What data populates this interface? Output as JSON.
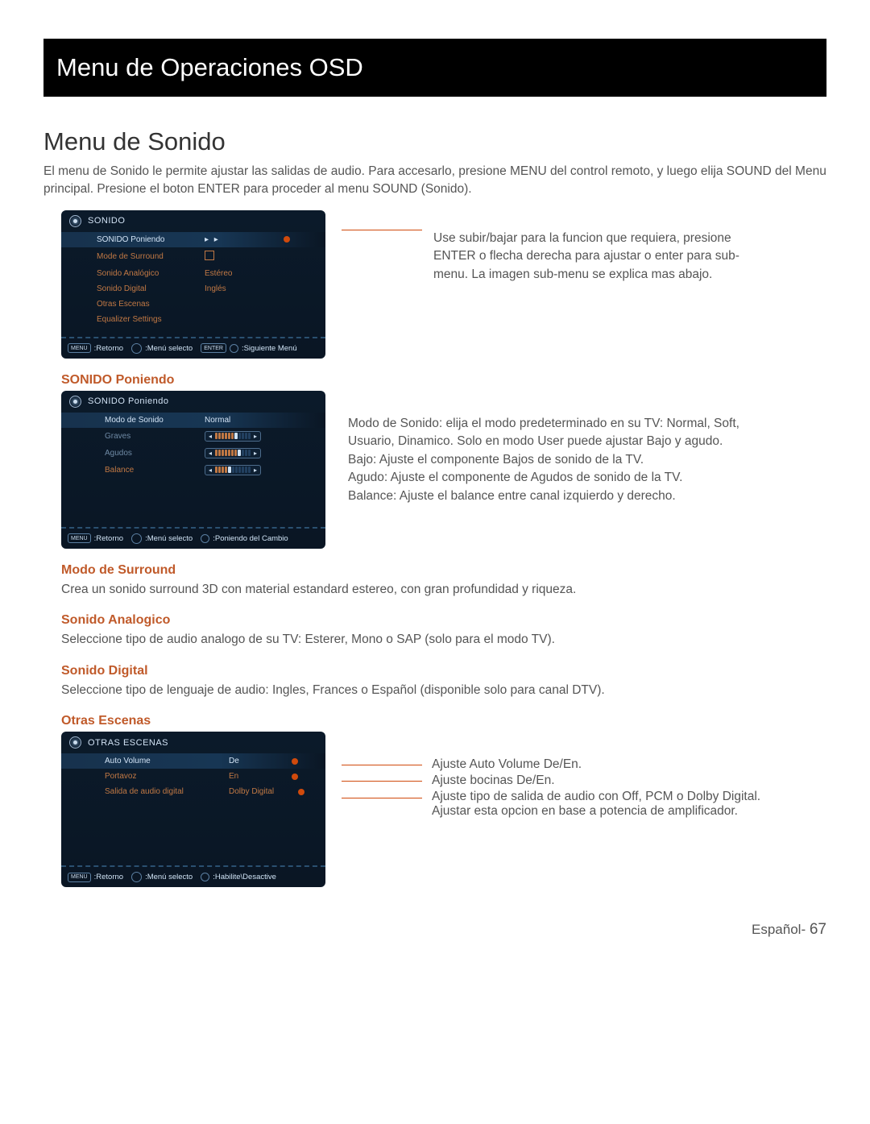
{
  "header_title": "Menu de Operaciones OSD",
  "main_heading": "Menu de Sonido",
  "intro": "El menu de Sonido le permite ajustar las salidas de audio. Para accesarlo, presione MENU del control remoto, y luego elija SOUND del Menu principal. Presione el boton ENTER para proceder al menu SOUND (Sonido).",
  "panel1": {
    "title": "SONIDO",
    "items": [
      {
        "label": "SONIDO Poniendo",
        "value_arrows": "▸ ▸"
      },
      {
        "label": "Mode de Surround"
      },
      {
        "label": "Sonido Analógico",
        "value": "Estéreo"
      },
      {
        "label": "Sonido Digital",
        "value": "Inglés"
      },
      {
        "label": "Otras Escenas"
      },
      {
        "label": "Equalizer Settings"
      }
    ],
    "footer": {
      "retorno": ":Retorno",
      "menu_sel": ":Menú selecto",
      "siguiente": ":Siguiente Menú",
      "menu_pill": "MENU",
      "enter_pill": "ENTER"
    }
  },
  "panel1_note": "Use subir/bajar para la funcion que requiera, presione ENTER o flecha derecha para ajustar o enter para sub-menu. La imagen sub-menu se explica mas abajo.",
  "sec_poniendo": "SONIDO Poniendo",
  "panel2": {
    "title": "SONIDO Poniendo",
    "items": [
      {
        "label": "Modo de Sonido",
        "value": "Normal"
      },
      {
        "label": "Graves"
      },
      {
        "label": "Agudos"
      },
      {
        "label": "Balance"
      }
    ],
    "footer": {
      "retorno": ":Retorno",
      "menu_sel": ":Menú selecto",
      "cambio": ":Poniendo del Cambio"
    }
  },
  "panel2_note": "Modo de Sonido: elija el modo predeterminado en su TV: Normal, Soft, Usuario, Dinamico. Solo en modo User puede ajustar Bajo y agudo.\nBajo:  Ajuste el componente Bajos de sonido de la TV.\nAgudo:  Ajuste el componente de Agudos de sonido de la TV.\nBalance: Ajuste el balance entre canal izquierdo y derecho.",
  "sec_surround": "Modo de Surround",
  "surround_desc": "Crea un sonido surround 3D con material estandard estereo, con gran profundidad y riqueza.",
  "sec_analog": "Sonido Analogico",
  "analog_desc": "Seleccione tipo de audio analogo de su TV: Esterer, Mono o SAP (solo para el modo TV).",
  "sec_digital": "Sonido Digital",
  "digital_desc": "Seleccione tipo de lenguaje de audio: Ingles, Frances o Español (disponible solo para canal DTV).",
  "sec_otras": "Otras Escenas",
  "panel3": {
    "title": "OTRAS ESCENAS",
    "items": [
      {
        "label": "Auto Volume",
        "value": "De"
      },
      {
        "label": "Portavoz",
        "value": "En"
      },
      {
        "label": "Salida de audio digital",
        "value": "Dolby Digital"
      }
    ],
    "footer": {
      "retorno": ":Retorno",
      "menu_sel": ":Menú selecto",
      "hab": ":Habilite\\Desactive"
    }
  },
  "panel3_notes": {
    "l1": "Ajuste Auto Volume De/En.",
    "l2": "Ajuste bocinas De/En.",
    "l3": "Ajuste tipo de salida de audio con Off, PCM o Dolby Digital.",
    "l4": "Ajustar esta opcion en base a potencia de amplificador."
  },
  "footer_lang": "Español-",
  "page_num": "67"
}
